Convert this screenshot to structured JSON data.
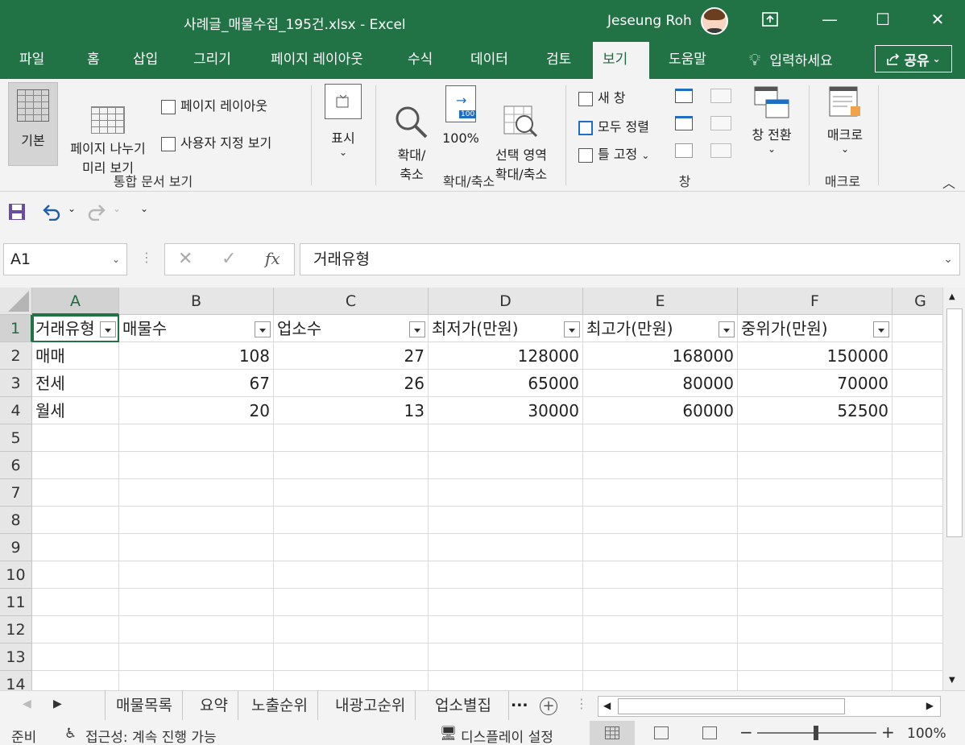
{
  "window": {
    "title": "사례글_매물수집_195건.xlsx  -  Excel",
    "user": "Jeseung Roh",
    "minimize": "—",
    "maximize": "☐",
    "close": "✕",
    "ribbon_display": "⊡"
  },
  "tabs": [
    "파일",
    "홈",
    "삽입",
    "그리기",
    "페이지 레이아웃",
    "수식",
    "데이터",
    "검토",
    "보기",
    "도움말"
  ],
  "active_tab": "보기",
  "tell_me": "입력하세요",
  "share_label": "공유",
  "ribbon": {
    "views": {
      "normal": "기본",
      "page_break": "페이지 나누기\n미리 보기",
      "page_layout": "페이지 레이아웃",
      "custom": "사용자 지정 보기",
      "group_label": "통합 문서 보기"
    },
    "show": {
      "label": "표시"
    },
    "zoom": {
      "zoom": "확대/\n축소",
      "hundred": "100%",
      "zoom_selection": "선택 영역\n확대/축소",
      "group_label": "확대/축소",
      "badge": "100"
    },
    "window": {
      "new_window": "새 창",
      "arrange_all": "모두 정렬",
      "freeze": "틀 고정",
      "switch": "창 전환",
      "group_label": "창"
    },
    "macros": {
      "label": "매크로",
      "group_label": "매크로"
    }
  },
  "formula_bar": {
    "name_box": "A1",
    "cancel": "✕",
    "enter": "✓",
    "fx": "fx",
    "content": "거래유형"
  },
  "columns": [
    "A",
    "B",
    "C",
    "D",
    "E",
    "F",
    "G"
  ],
  "rows": [
    "1",
    "2",
    "3",
    "4",
    "5",
    "6",
    "7",
    "8",
    "9",
    "10",
    "11",
    "12",
    "13",
    "14"
  ],
  "table": {
    "headers": [
      "거래유형",
      "매물수",
      "업소수",
      "최저가(만원)",
      "최고가(만원)",
      "중위가(만원)"
    ],
    "data": [
      [
        "매매",
        "108",
        "27",
        "128000",
        "168000",
        "150000"
      ],
      [
        "전세",
        "67",
        "26",
        "65000",
        "80000",
        "70000"
      ],
      [
        "월세",
        "20",
        "13",
        "30000",
        "60000",
        "52500"
      ]
    ]
  },
  "sheets": [
    "매물목록",
    "요약",
    "노출순위",
    "내광고순위",
    "업소별집"
  ],
  "sheet_more": "...",
  "status": {
    "ready": "준비",
    "accessibility": "접근성: 계속 진행 가능",
    "display": "디스플레이 설정",
    "zoom": "100%"
  },
  "colors": {
    "excel_green": "#217346"
  }
}
